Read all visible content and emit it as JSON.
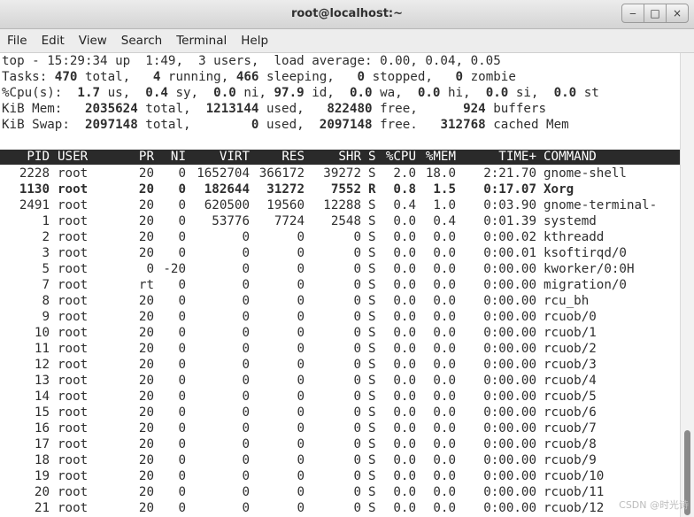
{
  "window": {
    "title": "root@localhost:~",
    "buttons": {
      "minimize": "‒",
      "maximize": "□",
      "close": "×"
    }
  },
  "menu": [
    "File",
    "Edit",
    "View",
    "Search",
    "Terminal",
    "Help"
  ],
  "summary": {
    "line1": "top - 15:29:34 up  1:49,  3 users,  load average: 0.00, 0.04, 0.05",
    "tasks": {
      "total": "470",
      "running": "4",
      "sleeping": "466",
      "stopped": "0",
      "zombie": "0"
    },
    "cpu": {
      "us": "1.7",
      "sy": "0.4",
      "ni": "0.0",
      "id": "97.9",
      "wa": "0.0",
      "hi": "0.0",
      "si": "0.0",
      "st": "0.0"
    },
    "mem": {
      "total": "2035624",
      "used": "1213144",
      "free": "822480",
      "buffers": "924"
    },
    "swap": {
      "total": "2097148",
      "used": "0",
      "free": "2097148",
      "cached": "312768"
    }
  },
  "columns": [
    "PID",
    "USER",
    "PR",
    "NI",
    "VIRT",
    "RES",
    "SHR",
    "S",
    "%CPU",
    "%MEM",
    "TIME+",
    "COMMAND"
  ],
  "processes": [
    {
      "pid": "2228",
      "user": "root",
      "pr": "20",
      "ni": "0",
      "virt": "1652704",
      "res": "366172",
      "shr": "39272",
      "s": "S",
      "cpu": "2.0",
      "mem": "18.0",
      "time": "2:21.70",
      "cmd": "gnome-shell",
      "bold": false
    },
    {
      "pid": "1130",
      "user": "root",
      "pr": "20",
      "ni": "0",
      "virt": "182644",
      "res": "31272",
      "shr": "7552",
      "s": "R",
      "cpu": "0.8",
      "mem": "1.5",
      "time": "0:17.07",
      "cmd": "Xorg",
      "bold": true
    },
    {
      "pid": "2491",
      "user": "root",
      "pr": "20",
      "ni": "0",
      "virt": "620500",
      "res": "19560",
      "shr": "12288",
      "s": "S",
      "cpu": "0.4",
      "mem": "1.0",
      "time": "0:03.90",
      "cmd": "gnome-terminal-",
      "bold": false
    },
    {
      "pid": "1",
      "user": "root",
      "pr": "20",
      "ni": "0",
      "virt": "53776",
      "res": "7724",
      "shr": "2548",
      "s": "S",
      "cpu": "0.0",
      "mem": "0.4",
      "time": "0:01.39",
      "cmd": "systemd",
      "bold": false
    },
    {
      "pid": "2",
      "user": "root",
      "pr": "20",
      "ni": "0",
      "virt": "0",
      "res": "0",
      "shr": "0",
      "s": "S",
      "cpu": "0.0",
      "mem": "0.0",
      "time": "0:00.02",
      "cmd": "kthreadd",
      "bold": false
    },
    {
      "pid": "3",
      "user": "root",
      "pr": "20",
      "ni": "0",
      "virt": "0",
      "res": "0",
      "shr": "0",
      "s": "S",
      "cpu": "0.0",
      "mem": "0.0",
      "time": "0:00.01",
      "cmd": "ksoftirqd/0",
      "bold": false
    },
    {
      "pid": "5",
      "user": "root",
      "pr": "0",
      "ni": "-20",
      "virt": "0",
      "res": "0",
      "shr": "0",
      "s": "S",
      "cpu": "0.0",
      "mem": "0.0",
      "time": "0:00.00",
      "cmd": "kworker/0:0H",
      "bold": false
    },
    {
      "pid": "7",
      "user": "root",
      "pr": "rt",
      "ni": "0",
      "virt": "0",
      "res": "0",
      "shr": "0",
      "s": "S",
      "cpu": "0.0",
      "mem": "0.0",
      "time": "0:00.00",
      "cmd": "migration/0",
      "bold": false
    },
    {
      "pid": "8",
      "user": "root",
      "pr": "20",
      "ni": "0",
      "virt": "0",
      "res": "0",
      "shr": "0",
      "s": "S",
      "cpu": "0.0",
      "mem": "0.0",
      "time": "0:00.00",
      "cmd": "rcu_bh",
      "bold": false
    },
    {
      "pid": "9",
      "user": "root",
      "pr": "20",
      "ni": "0",
      "virt": "0",
      "res": "0",
      "shr": "0",
      "s": "S",
      "cpu": "0.0",
      "mem": "0.0",
      "time": "0:00.00",
      "cmd": "rcuob/0",
      "bold": false
    },
    {
      "pid": "10",
      "user": "root",
      "pr": "20",
      "ni": "0",
      "virt": "0",
      "res": "0",
      "shr": "0",
      "s": "S",
      "cpu": "0.0",
      "mem": "0.0",
      "time": "0:00.00",
      "cmd": "rcuob/1",
      "bold": false
    },
    {
      "pid": "11",
      "user": "root",
      "pr": "20",
      "ni": "0",
      "virt": "0",
      "res": "0",
      "shr": "0",
      "s": "S",
      "cpu": "0.0",
      "mem": "0.0",
      "time": "0:00.00",
      "cmd": "rcuob/2",
      "bold": false
    },
    {
      "pid": "12",
      "user": "root",
      "pr": "20",
      "ni": "0",
      "virt": "0",
      "res": "0",
      "shr": "0",
      "s": "S",
      "cpu": "0.0",
      "mem": "0.0",
      "time": "0:00.00",
      "cmd": "rcuob/3",
      "bold": false
    },
    {
      "pid": "13",
      "user": "root",
      "pr": "20",
      "ni": "0",
      "virt": "0",
      "res": "0",
      "shr": "0",
      "s": "S",
      "cpu": "0.0",
      "mem": "0.0",
      "time": "0:00.00",
      "cmd": "rcuob/4",
      "bold": false
    },
    {
      "pid": "14",
      "user": "root",
      "pr": "20",
      "ni": "0",
      "virt": "0",
      "res": "0",
      "shr": "0",
      "s": "S",
      "cpu": "0.0",
      "mem": "0.0",
      "time": "0:00.00",
      "cmd": "rcuob/5",
      "bold": false
    },
    {
      "pid": "15",
      "user": "root",
      "pr": "20",
      "ni": "0",
      "virt": "0",
      "res": "0",
      "shr": "0",
      "s": "S",
      "cpu": "0.0",
      "mem": "0.0",
      "time": "0:00.00",
      "cmd": "rcuob/6",
      "bold": false
    },
    {
      "pid": "16",
      "user": "root",
      "pr": "20",
      "ni": "0",
      "virt": "0",
      "res": "0",
      "shr": "0",
      "s": "S",
      "cpu": "0.0",
      "mem": "0.0",
      "time": "0:00.00",
      "cmd": "rcuob/7",
      "bold": false
    },
    {
      "pid": "17",
      "user": "root",
      "pr": "20",
      "ni": "0",
      "virt": "0",
      "res": "0",
      "shr": "0",
      "s": "S",
      "cpu": "0.0",
      "mem": "0.0",
      "time": "0:00.00",
      "cmd": "rcuob/8",
      "bold": false
    },
    {
      "pid": "18",
      "user": "root",
      "pr": "20",
      "ni": "0",
      "virt": "0",
      "res": "0",
      "shr": "0",
      "s": "S",
      "cpu": "0.0",
      "mem": "0.0",
      "time": "0:00.00",
      "cmd": "rcuob/9",
      "bold": false
    },
    {
      "pid": "19",
      "user": "root",
      "pr": "20",
      "ni": "0",
      "virt": "0",
      "res": "0",
      "shr": "0",
      "s": "S",
      "cpu": "0.0",
      "mem": "0.0",
      "time": "0:00.00",
      "cmd": "rcuob/10",
      "bold": false
    },
    {
      "pid": "20",
      "user": "root",
      "pr": "20",
      "ni": "0",
      "virt": "0",
      "res": "0",
      "shr": "0",
      "s": "S",
      "cpu": "0.0",
      "mem": "0.0",
      "time": "0:00.00",
      "cmd": "rcuob/11",
      "bold": false
    },
    {
      "pid": "21",
      "user": "root",
      "pr": "20",
      "ni": "0",
      "virt": "0",
      "res": "0",
      "shr": "0",
      "s": "S",
      "cpu": "0.0",
      "mem": "0.0",
      "time": "0:00.00",
      "cmd": "rcuob/12",
      "bold": false
    }
  ],
  "watermark": "CSDN @时光诗"
}
